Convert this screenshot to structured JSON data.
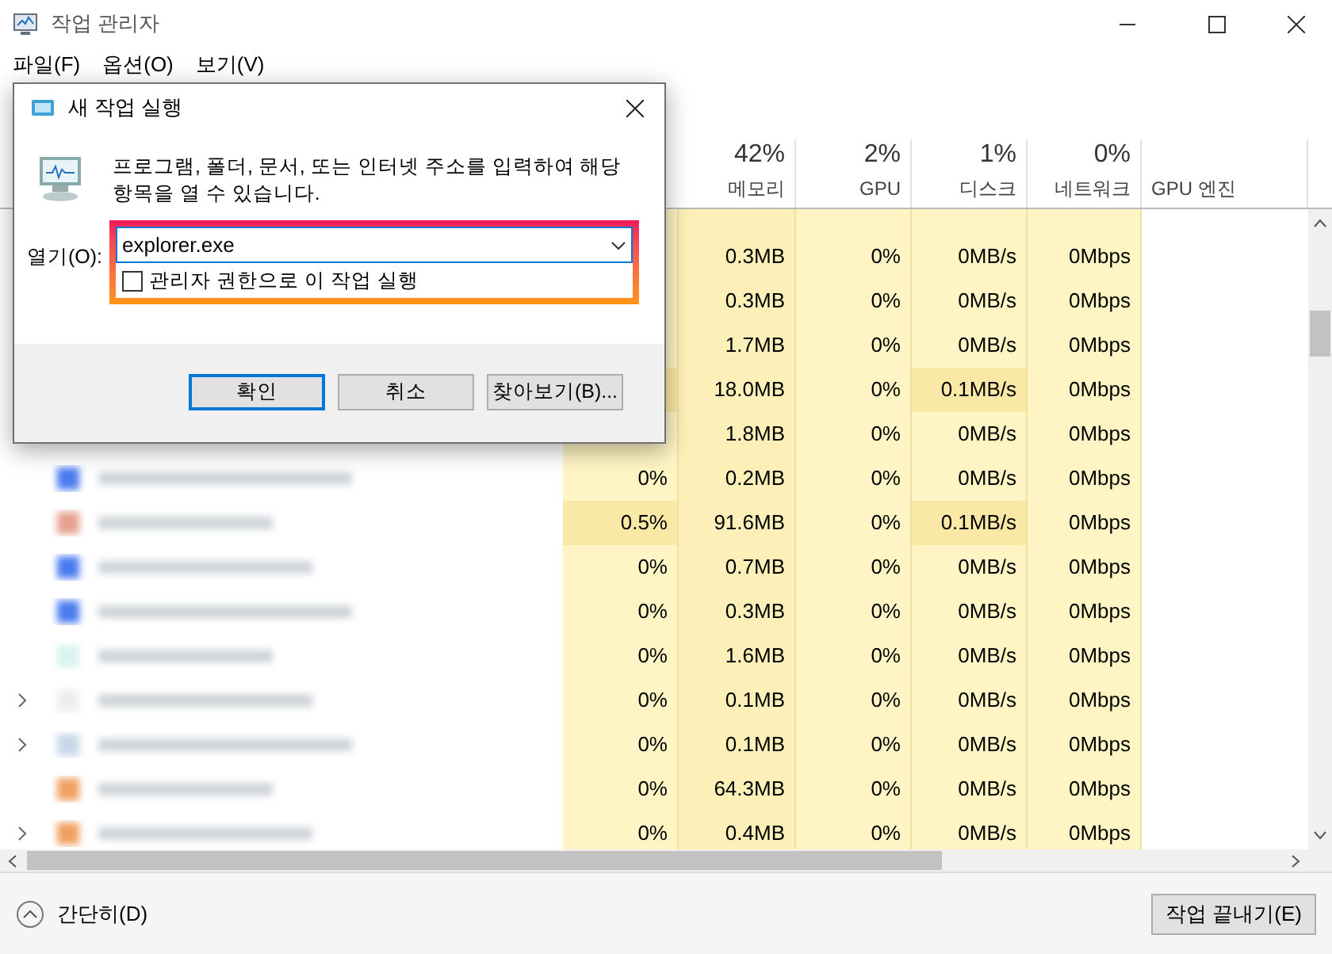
{
  "window": {
    "title": "작업 관리자"
  },
  "menu": [
    "파일(F)",
    "옵션(O)",
    "보기(V)"
  ],
  "columns": [
    {
      "percent": "42%",
      "label": "메모리"
    },
    {
      "percent": "2%",
      "label": "GPU"
    },
    {
      "percent": "1%",
      "label": "디스크"
    },
    {
      "percent": "0%",
      "label": "네트워크"
    },
    {
      "label": "GPU 엔진"
    }
  ],
  "rows": [
    {
      "cpu": "",
      "memory": "0.3MB",
      "gpu": "0%",
      "disk": "0MB/s",
      "network": "0Mbps",
      "busy": false
    },
    {
      "cpu": "",
      "memory": "0.3MB",
      "gpu": "0%",
      "disk": "0MB/s",
      "network": "0Mbps",
      "busy": false
    },
    {
      "cpu": "",
      "memory": "1.7MB",
      "gpu": "0%",
      "disk": "0MB/s",
      "network": "0Mbps",
      "busy": false
    },
    {
      "cpu": "",
      "memory": "18.0MB",
      "gpu": "0%",
      "disk": "0.1MB/s",
      "network": "0Mbps",
      "busy": true
    },
    {
      "cpu": "",
      "memory": "1.8MB",
      "gpu": "0%",
      "disk": "0MB/s",
      "network": "0Mbps",
      "busy": false
    },
    {
      "cpu": "0%",
      "memory": "0.2MB",
      "gpu": "0%",
      "disk": "0MB/s",
      "network": "0Mbps",
      "busy": false,
      "expandable": false,
      "color": "#4a7cf0"
    },
    {
      "cpu": "0.5%",
      "memory": "91.6MB",
      "gpu": "0%",
      "disk": "0.1MB/s",
      "network": "0Mbps",
      "busy": true,
      "expandable": false,
      "color": "#e8a090"
    },
    {
      "cpu": "0%",
      "memory": "0.7MB",
      "gpu": "0%",
      "disk": "0MB/s",
      "network": "0Mbps",
      "busy": false,
      "expandable": false,
      "color": "#4a7cf0"
    },
    {
      "cpu": "0%",
      "memory": "0.3MB",
      "gpu": "0%",
      "disk": "0MB/s",
      "network": "0Mbps",
      "busy": false,
      "expandable": false,
      "color": "#4a7cf0"
    },
    {
      "cpu": "0%",
      "memory": "1.6MB",
      "gpu": "0%",
      "disk": "0MB/s",
      "network": "0Mbps",
      "busy": false,
      "expandable": false,
      "color": "#d8f4ee"
    },
    {
      "cpu": "0%",
      "memory": "0.1MB",
      "gpu": "0%",
      "disk": "0MB/s",
      "network": "0Mbps",
      "busy": false,
      "expandable": true,
      "color": "#eeeeee"
    },
    {
      "cpu": "0%",
      "memory": "0.1MB",
      "gpu": "0%",
      "disk": "0MB/s",
      "network": "0Mbps",
      "busy": false,
      "expandable": true,
      "color": "#c8d8e8"
    },
    {
      "cpu": "0%",
      "memory": "64.3MB",
      "gpu": "0%",
      "disk": "0MB/s",
      "network": "0Mbps",
      "busy": false,
      "expandable": false,
      "color": "#f0a060"
    },
    {
      "cpu": "0%",
      "memory": "0.4MB",
      "gpu": "0%",
      "disk": "0MB/s",
      "network": "0Mbps",
      "busy": false,
      "expandable": true,
      "color": "#f0a060"
    }
  ],
  "footer": {
    "collapse": "간단히(D)",
    "end_task": "작업 끝내기(E)"
  },
  "dialog": {
    "title": "새 작업 실행",
    "message": "프로그램, 폴더, 문서, 또는 인터넷 주소를 입력하여 해당 항목을 열 수 있습니다.",
    "open_label": "열기(O):",
    "value": "explorer.exe",
    "admin": {
      "label": "관리자 권한으로 이 작업 실행",
      "checked": false
    },
    "buttons": [
      {
        "label": "확인",
        "focused": true
      },
      {
        "label": "취소",
        "focused": false
      },
      {
        "label": "찾아보기(B)...",
        "focused": false
      }
    ]
  }
}
